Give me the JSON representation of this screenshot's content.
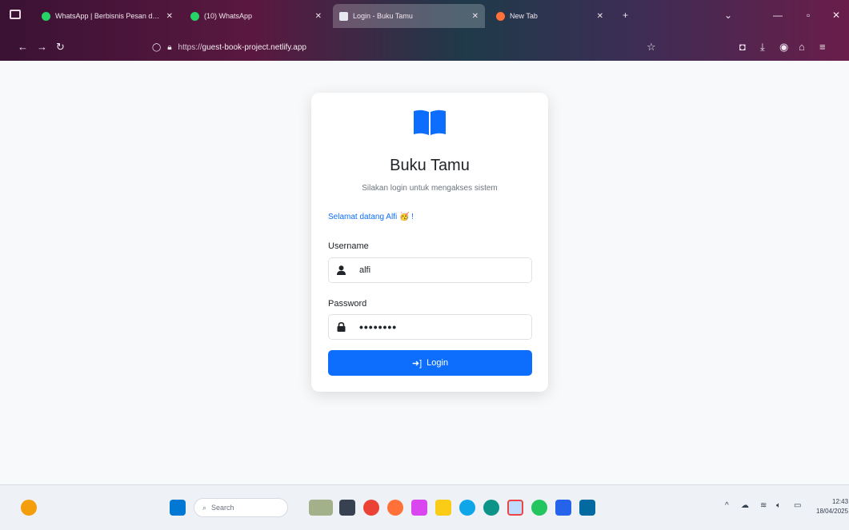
{
  "browser": {
    "tabs": [
      {
        "title": "WhatsApp | Berbisnis Pesan dan...",
        "favicon_color": "#25d366",
        "active": false
      },
      {
        "title": "(10) WhatsApp",
        "favicon_color": "#25d366",
        "active": false
      },
      {
        "title": "Login - Buku Tamu",
        "favicon_color": "#ffffff",
        "active": true
      },
      {
        "title": "New Tab",
        "favicon_color": "#ff7139",
        "active": false
      }
    ],
    "url_protocol": "https://",
    "url_host": "guest-book-project.netlify.app"
  },
  "login": {
    "title": "Buku Tamu",
    "subtitle": "Silakan login untuk mengakses sistem",
    "welcome": "Selamat datang Alfi 🥳 !",
    "username_label": "Username",
    "username_value": "alfi",
    "password_label": "Password",
    "password_value": "••••••••",
    "login_label": "Login"
  },
  "taskbar": {
    "search_placeholder": "Search",
    "time": "12:43",
    "date": "18/04/2025"
  },
  "colors": {
    "primary": "#0d6efd",
    "page_bg": "#f8f9fa"
  }
}
